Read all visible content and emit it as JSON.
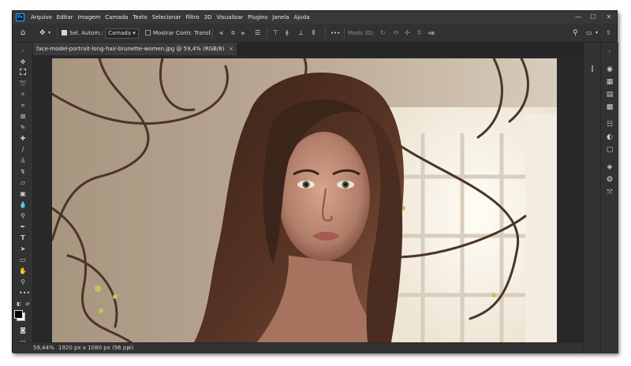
{
  "app": {
    "logo_text": "Ps"
  },
  "menu": [
    "Arquivo",
    "Editar",
    "Imagem",
    "Camada",
    "Texto",
    "Selecionar",
    "Filtro",
    "3D",
    "Visualizar",
    "Plugins",
    "Janela",
    "Ajuda"
  ],
  "window_controls": {
    "minimize": "—",
    "maximize": "☐",
    "close": "✕"
  },
  "options_bar": {
    "auto_select_label": "Sel. Autom.:",
    "auto_select_checked": true,
    "auto_select_target": "Camada",
    "show_transform_label": "Mostrar Contr. Transf.",
    "show_transform_checked": false,
    "mode_3d_label": "Modo 3D:",
    "more": "•••"
  },
  "document_tab": {
    "title": "face-model-portrait-long-hair-brunette-women.jpg @ 59,4% (RGB/8)",
    "close": "×"
  },
  "status_bar": {
    "zoom": "59,44%",
    "doc_info": "1920 px x 1080 px (96 ppi)",
    "arrow": "›"
  },
  "colors": {
    "window_bg": "#2d2d2d",
    "panel_bg": "#323232",
    "menubar_bg": "#383838",
    "foreground_swatch": "#000000",
    "background_swatch": "#ffffff",
    "ps_blue": "#31a8ff"
  }
}
